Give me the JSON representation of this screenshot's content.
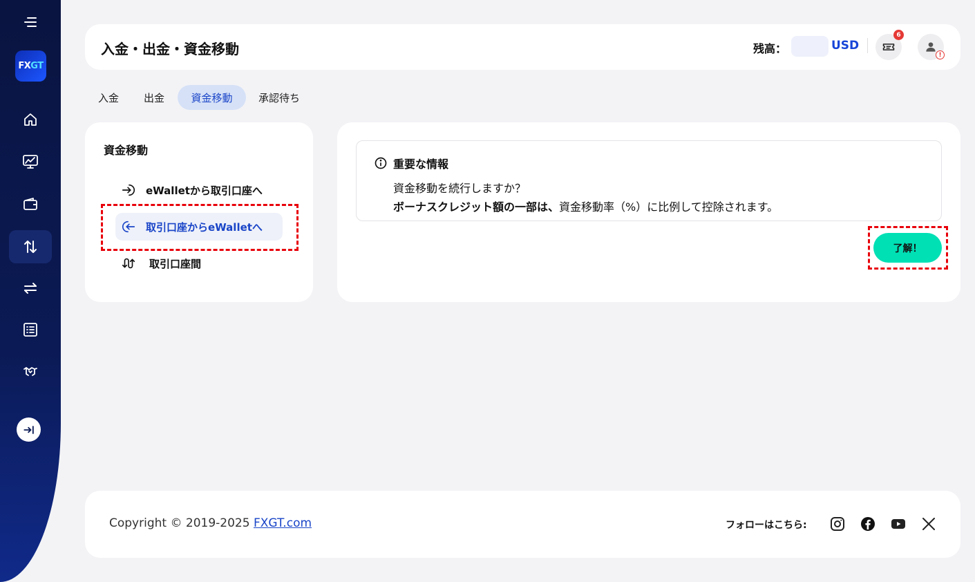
{
  "sidebar": {
    "logo_text": "FX",
    "logo_text_accent": "GT",
    "items": [
      {
        "icon": "home-icon"
      },
      {
        "icon": "chart-icon"
      },
      {
        "icon": "wallet-icon"
      },
      {
        "icon": "transfer-vertical-icon",
        "active": true
      },
      {
        "icon": "exchange-icon"
      },
      {
        "icon": "list-icon"
      },
      {
        "icon": "handshake-icon"
      }
    ],
    "expand_icon": "expand-icon"
  },
  "header": {
    "title": "入金・出金・資金移動",
    "balance_label": "残高：",
    "balance_currency": "USD",
    "notification_count": "6",
    "alert_mark": "!"
  },
  "tabs": [
    {
      "label": "入金"
    },
    {
      "label": "出金"
    },
    {
      "label": "資金移動",
      "active": true
    },
    {
      "label": "承認待ち"
    }
  ],
  "transfer_menu": {
    "title": "資金移動",
    "items": [
      {
        "label": "eWalletから取引口座へ",
        "icon": "arrow-in-icon"
      },
      {
        "label": "取引口座からeWalletへ",
        "icon": "arrow-out-icon",
        "active": true
      },
      {
        "label": "取引口座間",
        "icon": "between-accounts-icon"
      }
    ]
  },
  "notice": {
    "title": "重要な情報",
    "line1": "資金移動を続行しますか？",
    "line2_bold": "ボーナスクレジット額の一部は、",
    "line2_rest": "資金移動率（%）に比例して控除されます。",
    "ok_label": "了解！"
  },
  "footer": {
    "copyright": "Copyright © 2019-2025 ",
    "copyright_link": "FXGT.com",
    "follow_label": "フォローはこちら:",
    "social": [
      "instagram-icon",
      "facebook-icon",
      "youtube-icon",
      "x-icon"
    ]
  },
  "colors": {
    "accent": "#1a45c8",
    "ok_button": "#00e0b5",
    "sidebar": "#0b1a55",
    "highlight": "#e8000b"
  }
}
